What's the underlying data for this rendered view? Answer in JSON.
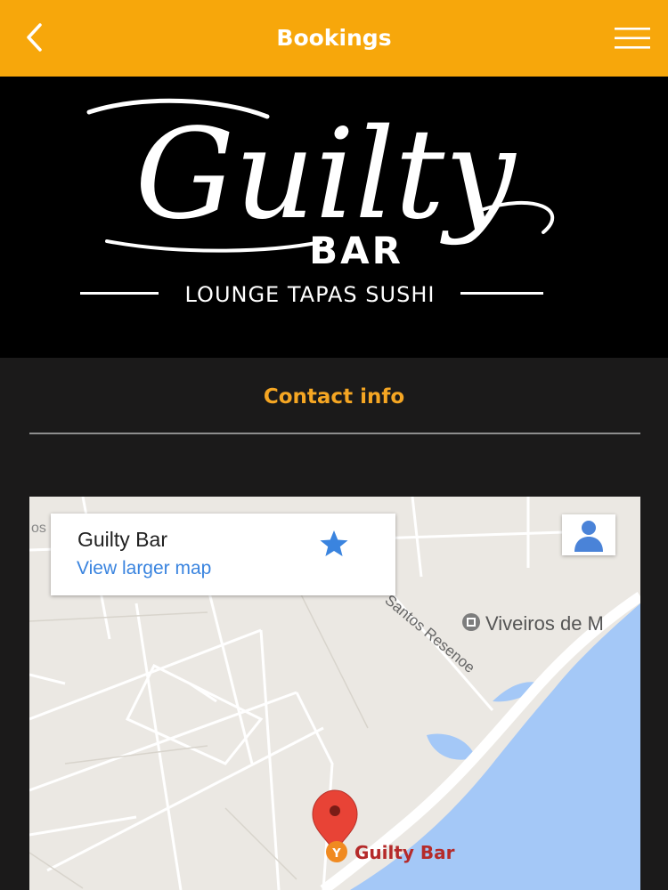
{
  "header": {
    "title": "Bookings",
    "back_icon": "chevron-left-icon",
    "menu_icon": "hamburger-menu-icon"
  },
  "logo": {
    "script": "Guilty",
    "bar": "BAR",
    "tagline": "LOUNGE  TAPAS  SUSHI"
  },
  "contact": {
    "title": "Contact info"
  },
  "map": {
    "place_name": "Guilty Bar",
    "view_larger": "View larger map",
    "street": "Santos Resenoe",
    "poi": "Viveiros de M",
    "marker_label": "Guilty Bar"
  },
  "colors": {
    "accent": "#f7a70b",
    "section_title": "#f5a623",
    "link": "#3a84df",
    "water": "#a4c8f7",
    "marker": "#e84336"
  }
}
